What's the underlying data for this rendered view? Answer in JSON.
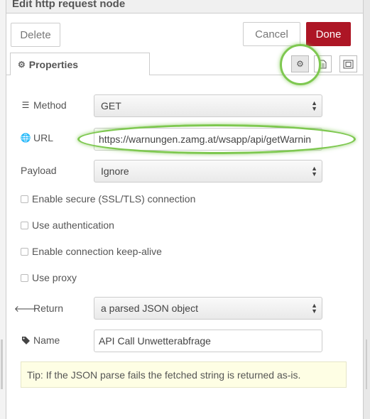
{
  "dialog": {
    "title": "Edit http request node"
  },
  "buttons": {
    "delete": "Delete",
    "cancel": "Cancel",
    "done": "Done"
  },
  "tabs": {
    "properties": "Properties"
  },
  "tab_icons": [
    "gear-icon",
    "document-icon",
    "frame-icon"
  ],
  "form": {
    "method": {
      "label": "Method",
      "value": "GET"
    },
    "url": {
      "label": "URL",
      "value": "https://warnungen.zamg.at/wsapp/api/getWarnin"
    },
    "payload": {
      "label": "Payload",
      "value": "Ignore"
    },
    "checkboxes": [
      {
        "label": "Enable secure (SSL/TLS) connection",
        "checked": false
      },
      {
        "label": "Use authentication",
        "checked": false
      },
      {
        "label": "Enable connection keep-alive",
        "checked": false
      },
      {
        "label": "Use proxy",
        "checked": false
      }
    ],
    "return": {
      "label": "Return",
      "value": "a parsed JSON object"
    },
    "name": {
      "label": "Name",
      "value": "API Call Unwetterabfrage"
    }
  },
  "tip": "Tip: If the JSON parse fails the fetched string is returned as-is.",
  "colors": {
    "done_button": "#ad1625",
    "highlight": "#7ec850",
    "tip_background": "#fefee4"
  }
}
